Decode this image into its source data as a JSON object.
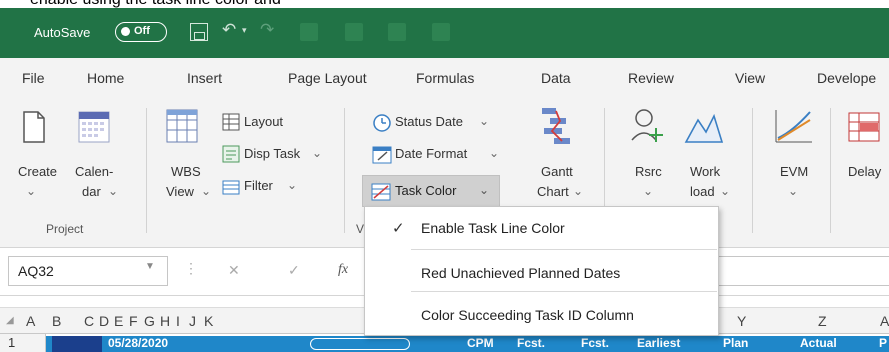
{
  "window": {
    "autosave_label": "AutoSave",
    "autosave_state": "Off",
    "theme_color": "#217346"
  },
  "tabs": [
    "File",
    "Home",
    "Insert",
    "Page Layout",
    "Formulas",
    "Data",
    "Review",
    "View",
    "Develope"
  ],
  "ribbon": {
    "create": "Create",
    "calendar_1": "Calen-",
    "calendar_2": "dar",
    "group_project": "Project",
    "wbs_1": "WBS",
    "wbs_2": "View",
    "layout": "Layout",
    "disp_task": "Disp Task",
    "filter": "Filter",
    "status_date": "Status Date",
    "date_format": "Date Format",
    "task_color": "Task Color",
    "gantt_1": "Gantt",
    "gantt_2": "Chart",
    "rsrc": "Rsrc",
    "work_1": "Work",
    "work_2": "load",
    "evm": "EVM",
    "delay": "Delay",
    "group_v": "V",
    "dropdown_caret": "⌄"
  },
  "task_color_menu": [
    {
      "label": "Enable Task Line Color",
      "checked": true
    },
    {
      "label": "Red Unachieved Planned Dates",
      "checked": false
    },
    {
      "label": "Color Succeeding Task ID Column",
      "checked": false
    }
  ],
  "formula_bar": {
    "name_box": "AQ32",
    "cancel": "✕",
    "enter": "✓",
    "fx": "fx",
    "value": ""
  },
  "columns": [
    "A",
    "B",
    "C",
    "D",
    "E",
    "F",
    "G",
    "H",
    "I",
    "J",
    "K",
    "Y",
    "Z",
    "A"
  ],
  "row1": {
    "row_number": "1",
    "date": "05/28/2020",
    "cpm": "CPM",
    "fcst_1": "Fcst.",
    "fcst_2": "Fcst.",
    "earliest": "Earliest",
    "plan": "Plan",
    "actual": "Actual",
    "p": "P"
  },
  "colors": {
    "accent_blue": "#1f87c9",
    "dark_blue": "#1b3f8c",
    "ribbon_bg": "#f3f3f3"
  }
}
